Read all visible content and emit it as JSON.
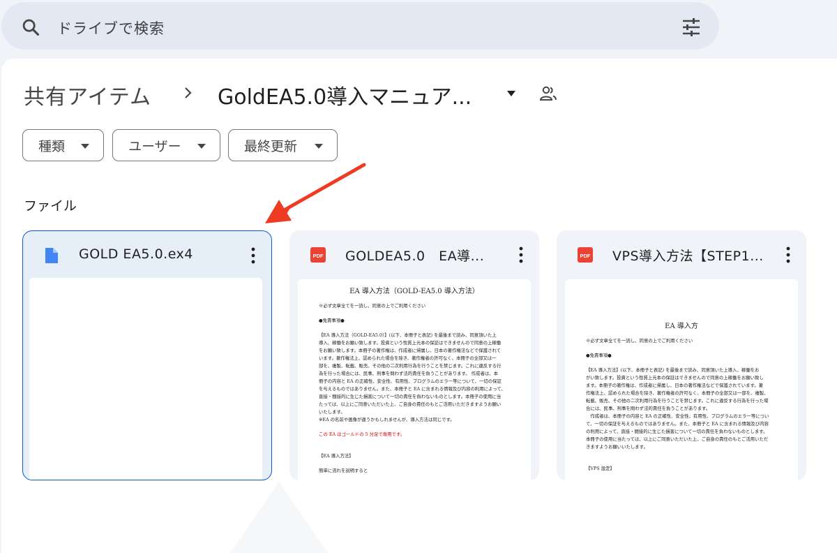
{
  "search": {
    "placeholder": "ドライブで検索"
  },
  "breadcrumb": {
    "root": "共有アイテム",
    "current": "GoldEA5.0導入マニュア..."
  },
  "filters": [
    {
      "label": "種類"
    },
    {
      "label": "ユーザー"
    },
    {
      "label": "最終更新"
    }
  ],
  "section_title": "ファイル",
  "files": [
    {
      "name": "GOLD EA5.0.ex4",
      "icon": "doc-file-icon",
      "selected": true
    },
    {
      "name": "GOLDEA5.0　EA導...",
      "icon": "pdf-icon",
      "preview": {
        "title": "EA 導入方法（GOLD-EA5.0 導入方法）",
        "lines": [
          "※必ず文章全てを一読し、同意の上でご利用ください",
          "●免責事項●",
          "【EA 導入方法（GOLD-EA5.0）】(以下、本冊子と表記) を最後まで読み、同意頂いた上",
          "導入、稼働をお願い致します。投資という性質上元本の保証はできませんので同意の上稼働",
          "をお願い致します。本冊子の著作権は、作成者に帰属し、日本の著作権法などで保護されて",
          "います。著作権法上、認められた場合を除き、著作権者の許可なく、本冊子の全部又は一",
          "部を、複製、転載、販売、その他の二次利用行為を行うことを禁じます。これに違反する行",
          "為を行った場合には、民事、刑事を問わず法的責任を負うことがあります。 作成者は、本",
          "冊子の内容と EA の正確性、安全性、有用性、プログラムのエラー等について、一切の保証",
          "を与えるものではありません。また、本冊子と EA に含まれる情報及び内容の利用によって、",
          "直接・間接的に生じた損害について一切の責任を負わないものとします。本冊子の使用に当",
          "たっては、以上にご同意いただいた上、ご自身の責任のもとご活用いただきますようお願い",
          "いたします。",
          "※EA の名前や画像が違うかもしれませんが、導入方法は同じです。"
        ],
        "red_line": "この EA はゴールドの 5 分足で専用です。",
        "tail": [
          "【EA 導入方法】",
          "簡単に流れを説明すると"
        ]
      }
    },
    {
      "name": "VPS導入方法【STEP1...",
      "icon": "pdf-icon",
      "preview": {
        "title": "EA 導入方",
        "lines": [
          "※必ず文章全てを一読し、同意の上でご利用ください",
          "●免責事項●",
          "【EA 導入方法】(以下、本冊子と表記) を最後まで読み、同意頂いた上導入、稼働をお",
          "がい致します。投資という性質上元本の保証はできませんので同意の上稼働をお願い致し",
          "ます。本冊子の著作権は、作成者に帰属し、日本の著作権法などで保護されています。著",
          "作権法上、認められた場合を除き、著作権者の許可なく、本冊子の全部又は一部を、複製、",
          "転載、販売、その他の二次利用行為を行うことを禁じます。これに違反する行為を行った場",
          "合には、民事、刑事を問わず法的責任を負うことがあります。",
          "　作成者は、本冊子の内容と EA の正確性、安全性、有用性、プログラムのエラー等につい",
          "て、一切の保証を与えるものではありません。また、本冊子と EA に含まれる情報及び内容",
          "の利用によって、直接・間接的に生じた損害について一切の責任を負わないものとします。",
          "本冊子の使用に当たっては、以上にご同意いただいた上、ご自身の責任のもとご活用いただ",
          "きますようお願いいたします。"
        ],
        "tail": [
          "【VPS 設定】"
        ]
      }
    }
  ],
  "colors": {
    "accent": "#0b57d0",
    "pdf_red": "#ea4335",
    "doc_blue": "#4285f4",
    "annotation_arrow": "#ee3b24"
  }
}
